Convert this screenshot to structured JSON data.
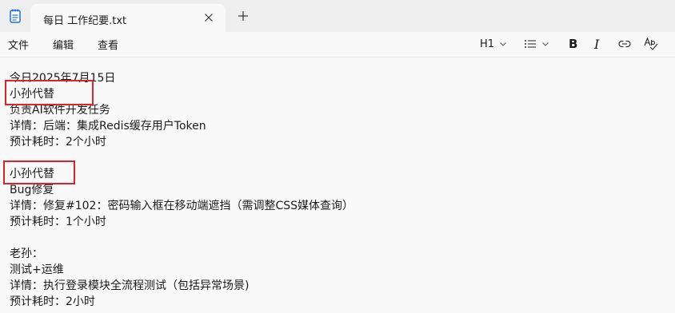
{
  "tab": {
    "title": "每日 工作纪要.txt"
  },
  "menu": {
    "file": "文件",
    "edit": "编辑",
    "view": "查看"
  },
  "toolbar": {
    "heading_label": "H1"
  },
  "editor": {
    "lines": [
      "今日2025年7月15日",
      "小孙代替",
      "负责AI软件开发任务",
      "详情：后端：集成Redis缓存用户Token",
      "预计耗时：2个小时",
      "",
      "小孙代替",
      "Bug修复",
      "详情：修复#102：密码输入框在移动端遮挡（需调整CSS媒体查询）",
      "预计耗时：1个小时",
      "",
      "老孙：",
      "测试+运维",
      "详情：执行登录模块全流程测试（包括异常场景)",
      "预计耗时：2小时"
    ]
  },
  "colors": {
    "highlight_border": "#d9262c",
    "app_icon": "#1e6fd9"
  },
  "icons": {
    "app": "notepad-icon",
    "close": "close-icon",
    "add": "plus-icon",
    "list": "list-icon",
    "link": "link-icon",
    "spellcheck": "spellcheck-icon"
  }
}
